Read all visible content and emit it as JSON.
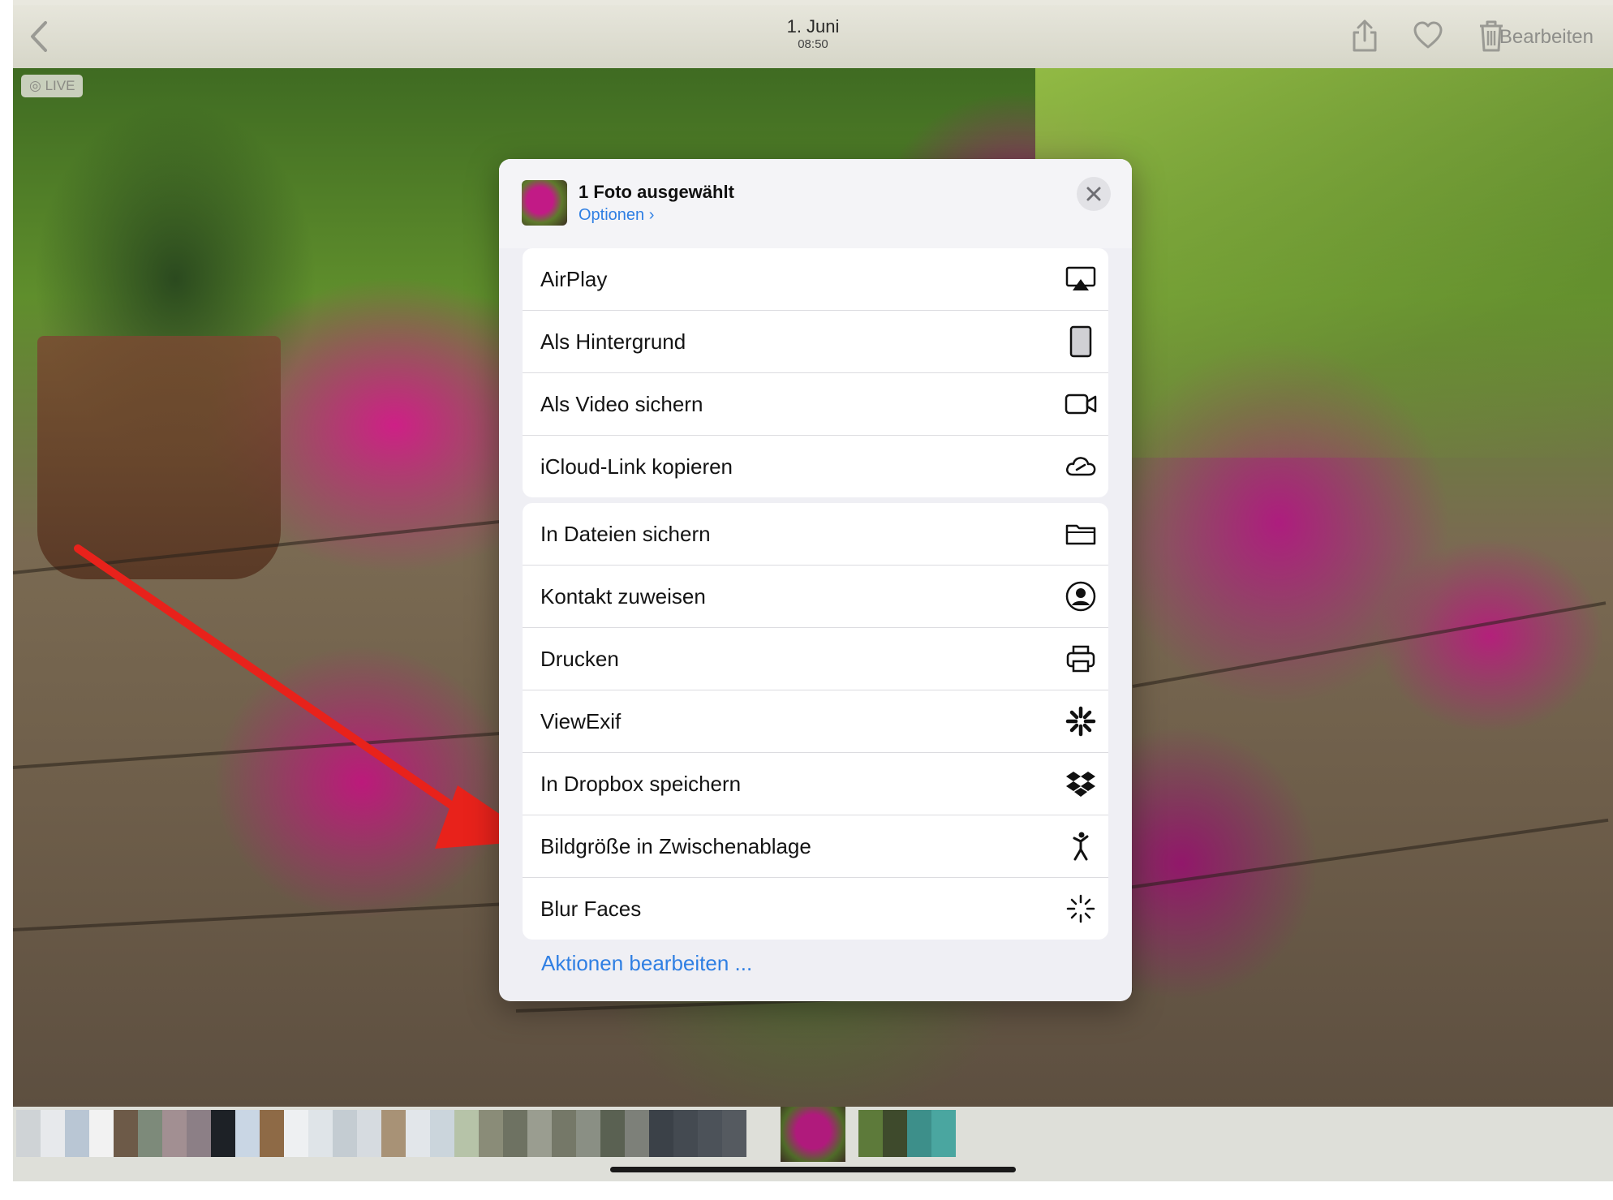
{
  "nav": {
    "date": "1. Juni",
    "time": "08:50",
    "edit_label": "Bearbeiten"
  },
  "photo": {
    "live_badge": "LIVE"
  },
  "share_sheet": {
    "title": "1 Foto ausgewählt",
    "options_label": "Optionen",
    "group1": [
      {
        "label": "AirPlay",
        "icon": "airplay-icon"
      },
      {
        "label": "Als Hintergrund",
        "icon": "wallpaper-icon"
      },
      {
        "label": "Als Video sichern",
        "icon": "video-icon"
      },
      {
        "label": "iCloud-Link kopieren",
        "icon": "icloud-link-icon"
      }
    ],
    "group2": [
      {
        "label": "In Dateien sichern",
        "icon": "folder-icon"
      },
      {
        "label": "Kontakt zuweisen",
        "icon": "contact-icon"
      },
      {
        "label": "Drucken",
        "icon": "printer-icon"
      },
      {
        "label": "ViewExif",
        "icon": "viewexif-icon"
      },
      {
        "label": "In Dropbox speichern",
        "icon": "dropbox-icon"
      },
      {
        "label": "Bildgröße in Zwischenablage",
        "icon": "figure-icon"
      },
      {
        "label": "Blur Faces",
        "icon": "sparkle-icon"
      }
    ],
    "edit_actions_label": "Aktionen bearbeiten ..."
  },
  "colors": {
    "accent": "#2f7fe3",
    "annotation_arrow": "#e8221b"
  }
}
